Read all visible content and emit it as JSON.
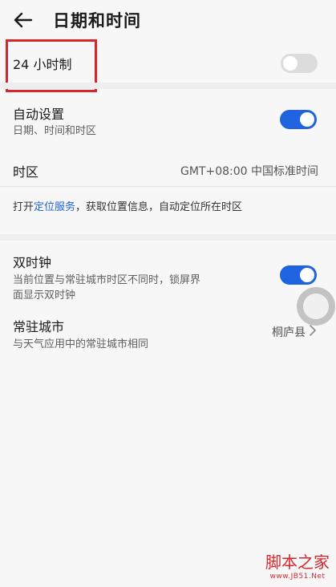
{
  "header": {
    "title": "日期和时间",
    "back_icon": "arrow-left-icon"
  },
  "hour24": {
    "label": "24 小时制",
    "toggle_state": "off"
  },
  "auto": {
    "title": "自动设置",
    "subtitle": "日期、时间和时区",
    "toggle_state": "on"
  },
  "timezone": {
    "label": "时区",
    "value": "GMT+08:00 中国标准时间"
  },
  "location_note": {
    "prefix": "打开",
    "link": "定位服务",
    "suffix": "，获取位置信息，自动定位所在时区"
  },
  "dual_clock": {
    "title": "双时钟",
    "subtitle_line1": "当前位置与常驻城市时区不同时，锁屏界",
    "subtitle_line2": "面显示双时钟",
    "toggle_state": "on"
  },
  "home_city": {
    "title": "常驻城市",
    "subtitle": "与天气应用中的常驻城市相同",
    "value": "桐庐县",
    "chevron_icon": "chevron-right-icon"
  },
  "watermark": {
    "text": "脚本之家",
    "url": "www.JB51.Net"
  },
  "colors": {
    "accent": "#1f63e0",
    "highlight": "#d7262b"
  }
}
